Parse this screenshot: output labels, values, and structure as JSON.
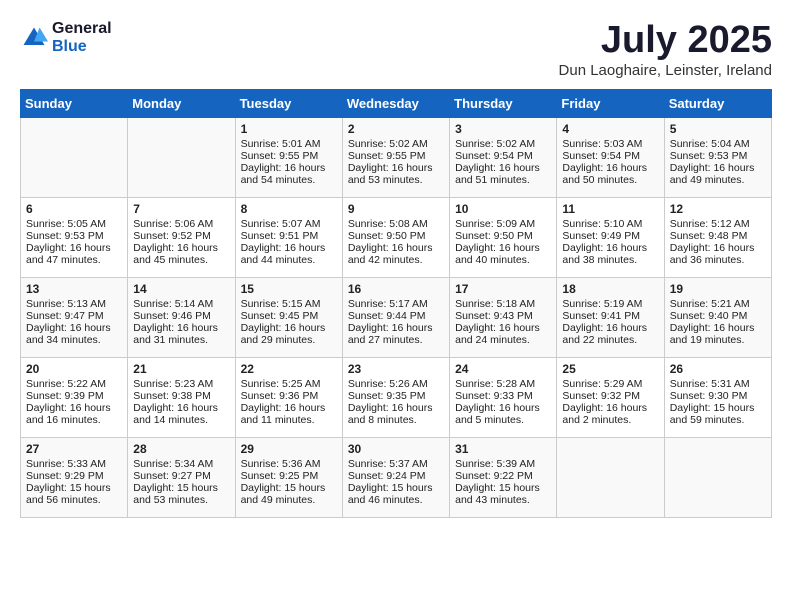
{
  "header": {
    "logo_general": "General",
    "logo_blue": "Blue",
    "month_title": "July 2025",
    "subtitle": "Dun Laoghaire, Leinster, Ireland"
  },
  "days_of_week": [
    "Sunday",
    "Monday",
    "Tuesday",
    "Wednesday",
    "Thursday",
    "Friday",
    "Saturday"
  ],
  "weeks": [
    [
      {
        "day": "",
        "info": ""
      },
      {
        "day": "",
        "info": ""
      },
      {
        "day": "1",
        "info": "Sunrise: 5:01 AM\nSunset: 9:55 PM\nDaylight: 16 hours and 54 minutes."
      },
      {
        "day": "2",
        "info": "Sunrise: 5:02 AM\nSunset: 9:55 PM\nDaylight: 16 hours and 53 minutes."
      },
      {
        "day": "3",
        "info": "Sunrise: 5:02 AM\nSunset: 9:54 PM\nDaylight: 16 hours and 51 minutes."
      },
      {
        "day": "4",
        "info": "Sunrise: 5:03 AM\nSunset: 9:54 PM\nDaylight: 16 hours and 50 minutes."
      },
      {
        "day": "5",
        "info": "Sunrise: 5:04 AM\nSunset: 9:53 PM\nDaylight: 16 hours and 49 minutes."
      }
    ],
    [
      {
        "day": "6",
        "info": "Sunrise: 5:05 AM\nSunset: 9:53 PM\nDaylight: 16 hours and 47 minutes."
      },
      {
        "day": "7",
        "info": "Sunrise: 5:06 AM\nSunset: 9:52 PM\nDaylight: 16 hours and 45 minutes."
      },
      {
        "day": "8",
        "info": "Sunrise: 5:07 AM\nSunset: 9:51 PM\nDaylight: 16 hours and 44 minutes."
      },
      {
        "day": "9",
        "info": "Sunrise: 5:08 AM\nSunset: 9:50 PM\nDaylight: 16 hours and 42 minutes."
      },
      {
        "day": "10",
        "info": "Sunrise: 5:09 AM\nSunset: 9:50 PM\nDaylight: 16 hours and 40 minutes."
      },
      {
        "day": "11",
        "info": "Sunrise: 5:10 AM\nSunset: 9:49 PM\nDaylight: 16 hours and 38 minutes."
      },
      {
        "day": "12",
        "info": "Sunrise: 5:12 AM\nSunset: 9:48 PM\nDaylight: 16 hours and 36 minutes."
      }
    ],
    [
      {
        "day": "13",
        "info": "Sunrise: 5:13 AM\nSunset: 9:47 PM\nDaylight: 16 hours and 34 minutes."
      },
      {
        "day": "14",
        "info": "Sunrise: 5:14 AM\nSunset: 9:46 PM\nDaylight: 16 hours and 31 minutes."
      },
      {
        "day": "15",
        "info": "Sunrise: 5:15 AM\nSunset: 9:45 PM\nDaylight: 16 hours and 29 minutes."
      },
      {
        "day": "16",
        "info": "Sunrise: 5:17 AM\nSunset: 9:44 PM\nDaylight: 16 hours and 27 minutes."
      },
      {
        "day": "17",
        "info": "Sunrise: 5:18 AM\nSunset: 9:43 PM\nDaylight: 16 hours and 24 minutes."
      },
      {
        "day": "18",
        "info": "Sunrise: 5:19 AM\nSunset: 9:41 PM\nDaylight: 16 hours and 22 minutes."
      },
      {
        "day": "19",
        "info": "Sunrise: 5:21 AM\nSunset: 9:40 PM\nDaylight: 16 hours and 19 minutes."
      }
    ],
    [
      {
        "day": "20",
        "info": "Sunrise: 5:22 AM\nSunset: 9:39 PM\nDaylight: 16 hours and 16 minutes."
      },
      {
        "day": "21",
        "info": "Sunrise: 5:23 AM\nSunset: 9:38 PM\nDaylight: 16 hours and 14 minutes."
      },
      {
        "day": "22",
        "info": "Sunrise: 5:25 AM\nSunset: 9:36 PM\nDaylight: 16 hours and 11 minutes."
      },
      {
        "day": "23",
        "info": "Sunrise: 5:26 AM\nSunset: 9:35 PM\nDaylight: 16 hours and 8 minutes."
      },
      {
        "day": "24",
        "info": "Sunrise: 5:28 AM\nSunset: 9:33 PM\nDaylight: 16 hours and 5 minutes."
      },
      {
        "day": "25",
        "info": "Sunrise: 5:29 AM\nSunset: 9:32 PM\nDaylight: 16 hours and 2 minutes."
      },
      {
        "day": "26",
        "info": "Sunrise: 5:31 AM\nSunset: 9:30 PM\nDaylight: 15 hours and 59 minutes."
      }
    ],
    [
      {
        "day": "27",
        "info": "Sunrise: 5:33 AM\nSunset: 9:29 PM\nDaylight: 15 hours and 56 minutes."
      },
      {
        "day": "28",
        "info": "Sunrise: 5:34 AM\nSunset: 9:27 PM\nDaylight: 15 hours and 53 minutes."
      },
      {
        "day": "29",
        "info": "Sunrise: 5:36 AM\nSunset: 9:25 PM\nDaylight: 15 hours and 49 minutes."
      },
      {
        "day": "30",
        "info": "Sunrise: 5:37 AM\nSunset: 9:24 PM\nDaylight: 15 hours and 46 minutes."
      },
      {
        "day": "31",
        "info": "Sunrise: 5:39 AM\nSunset: 9:22 PM\nDaylight: 15 hours and 43 minutes."
      },
      {
        "day": "",
        "info": ""
      },
      {
        "day": "",
        "info": ""
      }
    ]
  ]
}
